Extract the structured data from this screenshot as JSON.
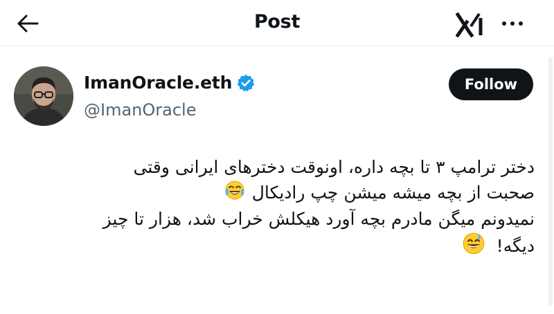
{
  "header": {
    "title": "Post",
    "back_icon": "arrow-left-icon",
    "grok_icon": "grok-logo-icon",
    "more_icon": "more-dots-icon"
  },
  "author": {
    "display_name": "ImanOracle.eth",
    "handle": "@ImanOracle",
    "verified_icon": "verified-badge-icon",
    "verified_color": "#1d9bf0"
  },
  "follow_button": {
    "label": "Follow",
    "background": "#0f1419"
  },
  "post": {
    "lines": [
      "دختر ترامپ ۳ تا بچه داره، اونوقت دخترهای ایرانی وقتی",
      "صحبت از بچه میشه میشن چپ رادیکال",
      "نمیدونم میگن مادرم بچه آورد هیکلش خراب شد، هزار تا چیز",
      "دیگه!"
    ],
    "emoji_1": "face-with-tears-of-joy-icon",
    "emoji_2": "grinning-face-with-sweat-icon"
  }
}
